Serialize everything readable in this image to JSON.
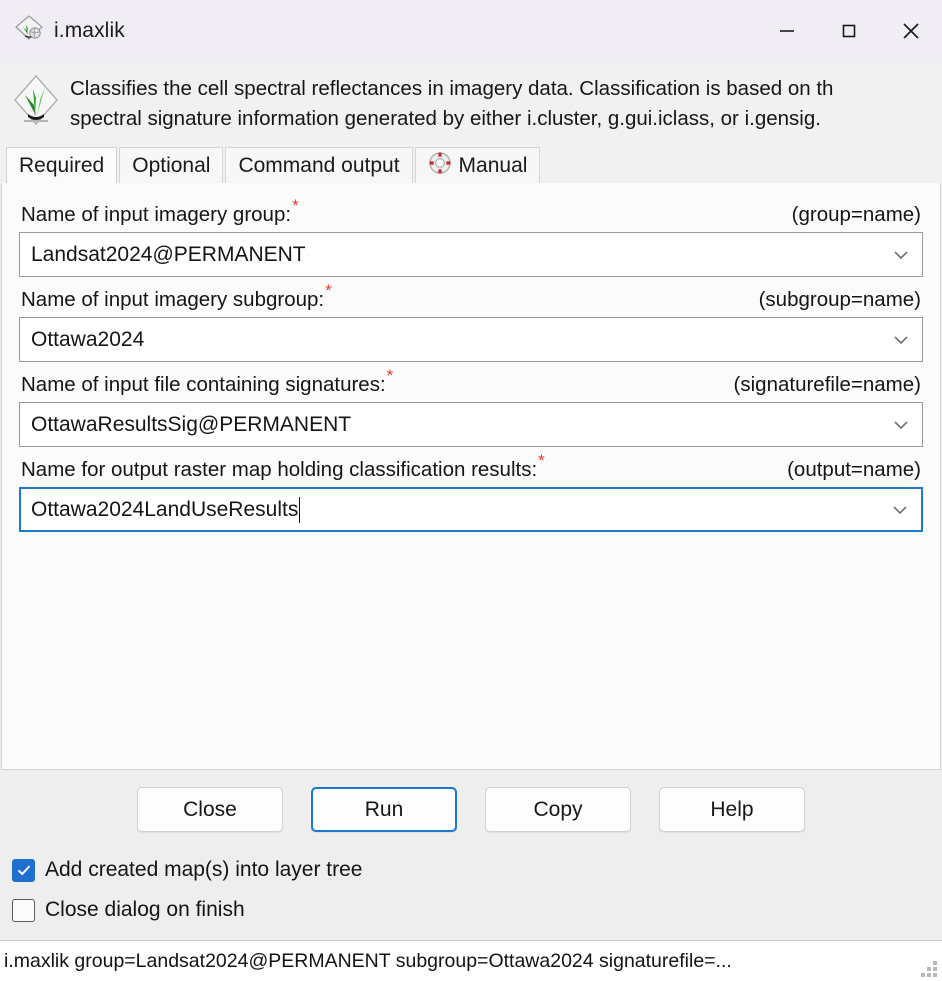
{
  "window": {
    "title": "i.maxlik",
    "icon": "grass-gis-icon",
    "controls": [
      {
        "name": "minimize-button",
        "glyph": "—"
      },
      {
        "name": "maximize-button",
        "glyph": "□"
      },
      {
        "name": "close-button",
        "glyph": "✕"
      }
    ]
  },
  "description": {
    "icon": "grass-gis-large-icon",
    "line1": "Classifies the cell spectral reflectances in imagery data. Classification is based on th",
    "line2": "spectral signature information generated by either i.cluster, g.gui.iclass, or i.gensig."
  },
  "tabs": [
    {
      "label": "Required",
      "active": true,
      "icon": null
    },
    {
      "label": "Optional",
      "active": false,
      "icon": null
    },
    {
      "label": "Command output",
      "active": false,
      "icon": null
    },
    {
      "label": "Manual",
      "active": false,
      "icon": "lifebuoy-icon"
    }
  ],
  "fields": [
    {
      "name": "input-imagery-group",
      "label": "Name of input imagery group:",
      "required": true,
      "hint": "(group=name)",
      "value": "Landsat2024@PERMANENT",
      "focused": false,
      "caret": false
    },
    {
      "name": "input-imagery-subgroup",
      "label": "Name of input imagery subgroup:",
      "required": true,
      "hint": "(subgroup=name)",
      "value": "Ottawa2024",
      "focused": false,
      "caret": false
    },
    {
      "name": "input-signature-file",
      "label": "Name of input file containing signatures:",
      "required": true,
      "hint": "(signaturefile=name)",
      "value": "OttawaResultsSig@PERMANENT",
      "focused": false,
      "caret": false
    },
    {
      "name": "output-raster-map",
      "label": "Name for output raster map holding classification results:",
      "required": true,
      "hint": "(output=name)",
      "value": "Ottawa2024LandUseResults",
      "focused": true,
      "caret": true
    }
  ],
  "buttons": [
    {
      "name": "close-button",
      "label": "Close",
      "primary": false
    },
    {
      "name": "run-button",
      "label": "Run",
      "primary": true
    },
    {
      "name": "copy-button",
      "label": "Copy",
      "primary": false
    },
    {
      "name": "help-button",
      "label": "Help",
      "primary": false
    }
  ],
  "checkboxes": [
    {
      "name": "add-created-maps-checkbox",
      "label": "Add created map(s) into layer tree",
      "checked": true
    },
    {
      "name": "close-dialog-on-finish-checkbox",
      "label": "Close dialog on finish",
      "checked": false
    }
  ],
  "statusbar": {
    "command": "i.maxlik group=Landsat2024@PERMANENT subgroup=Ottawa2024 signaturefile=..."
  },
  "colors": {
    "accent": "#1878d4",
    "required_star": "#e23c2e",
    "checkbox_checked": "#1f6fd0",
    "titlebar_bg": "#f0edf5",
    "panel_bg": "#fbfbfb",
    "chrome_bg": "#eeeeee"
  }
}
